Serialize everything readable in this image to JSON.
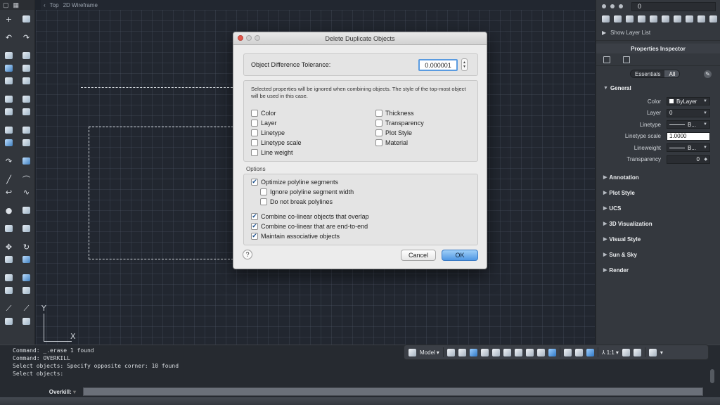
{
  "viewport": {
    "back_arrow": "‹",
    "view": "Top",
    "visual_style": "2D Wireframe"
  },
  "ucs": {
    "y": "Y",
    "x": "X"
  },
  "dialog": {
    "title": "Delete Duplicate Objects",
    "tolerance_label": "Object Difference Tolerance:",
    "tolerance_value": "0.000001",
    "description": "Selected properties will be ignored when combining objects. The style of the top-most object will be used in this case.",
    "properties_left": [
      {
        "label": "Color",
        "checked": false
      },
      {
        "label": "Layer",
        "checked": false
      },
      {
        "label": "Linetype",
        "checked": false
      },
      {
        "label": "Linetype scale",
        "checked": false
      },
      {
        "label": "Line weight",
        "checked": false
      }
    ],
    "properties_right": [
      {
        "label": "Thickness",
        "checked": false
      },
      {
        "label": "Transparency",
        "checked": false
      },
      {
        "label": "Plot Style",
        "checked": false
      },
      {
        "label": "Material",
        "checked": false
      }
    ],
    "options_label": "Options",
    "options": [
      {
        "label": "Optimize polyline segments",
        "checked": true
      },
      {
        "label": "Ignore polyline segment width",
        "checked": false
      },
      {
        "label": "Do not break polylines",
        "checked": false
      },
      {
        "label": "Combine co-linear objects that overlap",
        "checked": true
      },
      {
        "label": "Combine co-linear that are end-to-end",
        "checked": true
      },
      {
        "label": "Maintain associative objects",
        "checked": true
      }
    ],
    "help": "?",
    "cancel": "Cancel",
    "ok": "OK"
  },
  "layers": {
    "current": "0",
    "show_layer_list": "Show Layer List"
  },
  "inspector": {
    "title": "Properties Inspector",
    "tab_essentials": "Essentials",
    "tab_all": "All",
    "general": "General",
    "props": [
      {
        "label": "Color",
        "value": "ByLayer"
      },
      {
        "label": "Layer",
        "value": "0"
      },
      {
        "label": "Linetype",
        "value": "B..."
      },
      {
        "label": "Linetype scale",
        "value": "1.0000"
      },
      {
        "label": "Lineweight",
        "value": "B..."
      },
      {
        "label": "Transparency",
        "value": "0"
      }
    ],
    "sections": [
      "Annotation",
      "Plot Style",
      "UCS",
      "3D Visualization",
      "Visual Style",
      "Sun & Sky",
      "Render"
    ]
  },
  "command": {
    "lines": [
      "Command: _.erase 1 found",
      "Command: OVERKILL",
      "Select objects: Specify opposite corner: 10 found",
      "Select objects:"
    ],
    "prompt_label": "Overkill:"
  },
  "statusbar": {
    "model": "Model",
    "scale": "1:1"
  }
}
